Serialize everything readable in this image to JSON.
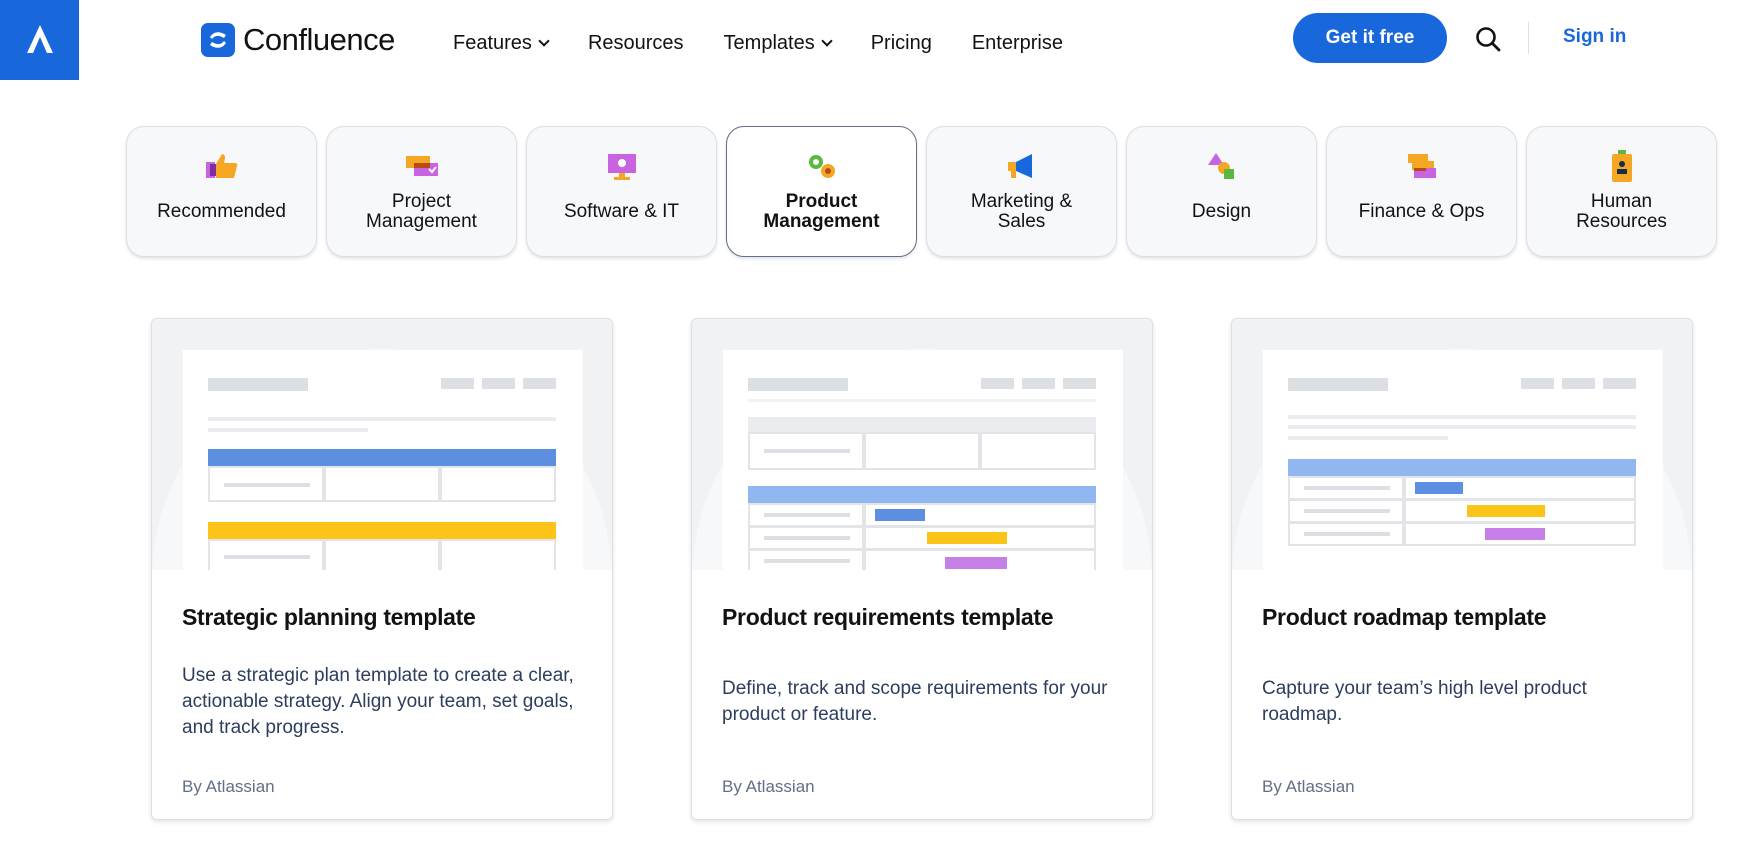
{
  "header": {
    "brand": "Confluence",
    "nav": [
      {
        "label": "Features",
        "dropdown": true
      },
      {
        "label": "Resources",
        "dropdown": false
      },
      {
        "label": "Templates",
        "dropdown": true
      },
      {
        "label": "Pricing",
        "dropdown": false
      },
      {
        "label": "Enterprise",
        "dropdown": false
      }
    ],
    "cta_label": "Get it free",
    "signin_label": "Sign in",
    "colors": {
      "brand_blue": "#1868db"
    }
  },
  "categories": [
    {
      "label": "Recommended",
      "icon": "thumbs-up-icon",
      "active": false
    },
    {
      "label": "Project\nManagement",
      "icon": "project-cards-icon",
      "active": false
    },
    {
      "label": "Software & IT",
      "icon": "monitor-icon",
      "active": false
    },
    {
      "label": "Product\nManagement",
      "icon": "gears-icon",
      "active": true
    },
    {
      "label": "Marketing &\nSales",
      "icon": "megaphone-icon",
      "active": false
    },
    {
      "label": "Design",
      "icon": "shapes-icon",
      "active": false
    },
    {
      "label": "Finance & Ops",
      "icon": "stacked-cards-icon",
      "active": false
    },
    {
      "label": "Human\nResources",
      "icon": "id-badge-icon",
      "active": false
    }
  ],
  "cards": [
    {
      "title": "Strategic planning template",
      "description": "Use a strategic plan template to create a clear, actionable strategy. Align your team, set goals, and track progress.",
      "author": "By Atlassian"
    },
    {
      "title": "Product requirements template",
      "description": "Define, track and scope requirements for your product or feature.",
      "author": "By Atlassian"
    },
    {
      "title": "Product roadmap template",
      "description": "Capture your team’s high level product roadmap.",
      "author": "By Atlassian"
    }
  ]
}
